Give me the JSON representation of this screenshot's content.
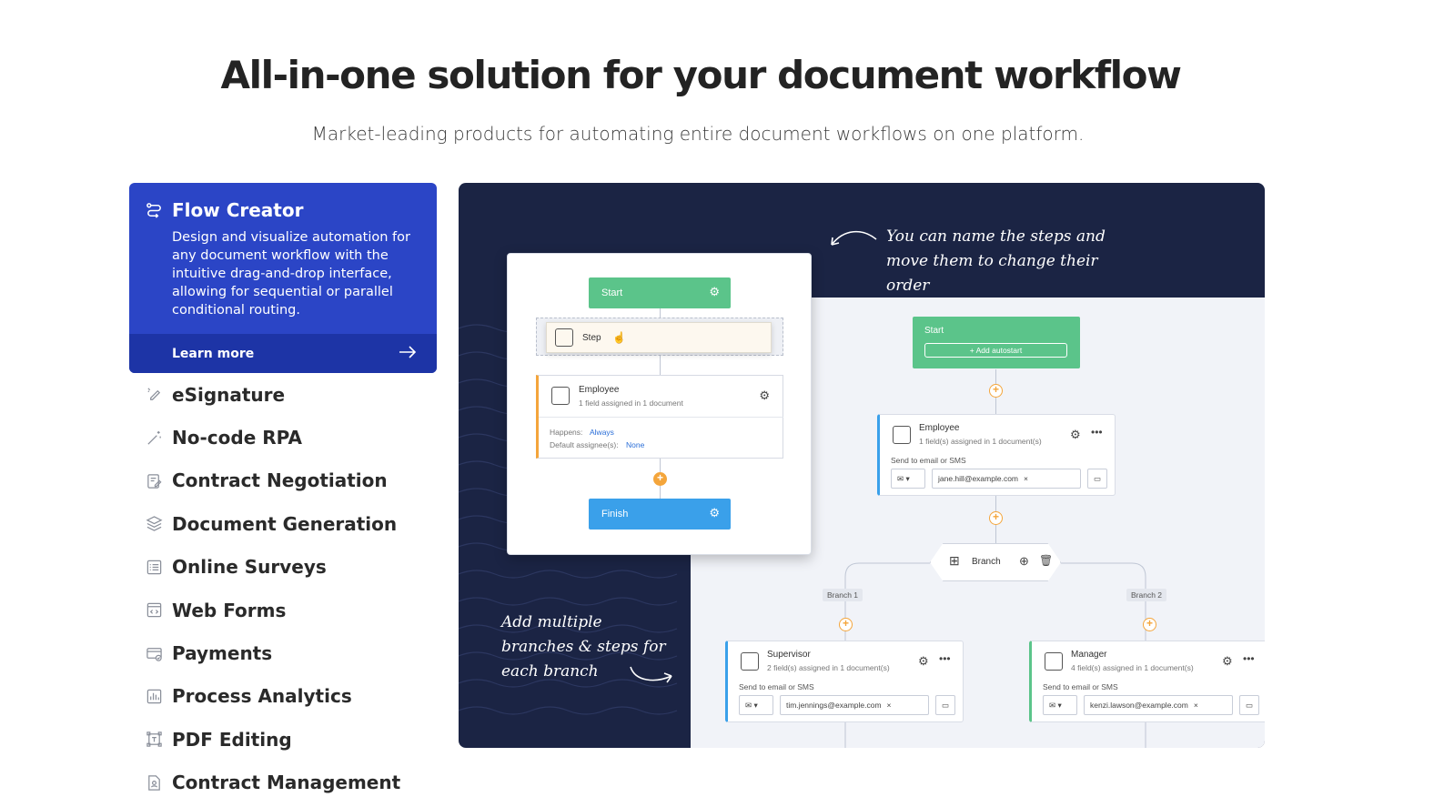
{
  "header": {
    "title": "All-in-one solution for your document workflow",
    "subtitle": "Market-leading products for automating entire document workflows on one platform."
  },
  "menu": {
    "active": {
      "title": "Flow Creator",
      "description": "Design and visualize automation for any document workflow with the intuitive drag-and-drop interface, allowing for sequential or parallel conditional routing.",
      "link_label": "Learn more"
    },
    "items": [
      {
        "label": "eSignature",
        "icon": "esignature-icon"
      },
      {
        "label": "No-code RPA",
        "icon": "magic-wand-icon"
      },
      {
        "label": "Contract Negotiation",
        "icon": "contract-edit-icon"
      },
      {
        "label": "Document Generation",
        "icon": "layers-icon"
      },
      {
        "label": "Online Surveys",
        "icon": "checklist-icon"
      },
      {
        "label": "Web Forms",
        "icon": "code-window-icon"
      },
      {
        "label": "Payments",
        "icon": "card-check-icon"
      },
      {
        "label": "Process Analytics",
        "icon": "bar-chart-icon"
      },
      {
        "label": "PDF Editing",
        "icon": "text-frame-icon"
      },
      {
        "label": "Contract Management",
        "icon": "user-document-icon"
      }
    ]
  },
  "preview": {
    "note_top": "You can name the steps and move them to change their order",
    "note_bottom": "Add multiple branches & steps for each branch",
    "small_flow": {
      "start": "Start",
      "step": "Step",
      "employee": "Employee",
      "employee_sub": "1 field assigned in 1 document",
      "happens_label": "Happens:",
      "happens_value": "Always",
      "assignee_label": "Default assignee(s):",
      "assignee_value": "None",
      "finish": "Finish"
    },
    "big_flow": {
      "start": "Start",
      "autostart": "+ Add autostart",
      "employee": "Employee",
      "employee_sub": "1 field(s) assigned in 1 document(s)",
      "send_label": "Send to email or SMS",
      "employee_email": "jane.hill@example.com",
      "branch": "Branch",
      "branch1": "Branch 1",
      "branch2": "Branch 2",
      "supervisor": "Supervisor",
      "supervisor_sub": "2 field(s) assigned in 1 document(s)",
      "supervisor_email": "tim.jennings@example.com",
      "manager": "Manager",
      "manager_sub": "4 field(s) assigned in 1 document(s)",
      "manager_email": "kenzi.lawson@example.com"
    }
  },
  "colors": {
    "accent": "#2b45c6",
    "accent_dark": "#1d34a6",
    "dark_bg": "#1b2444",
    "green": "#5bc48a",
    "blue": "#3aa0ea",
    "orange": "#f4a53b"
  }
}
